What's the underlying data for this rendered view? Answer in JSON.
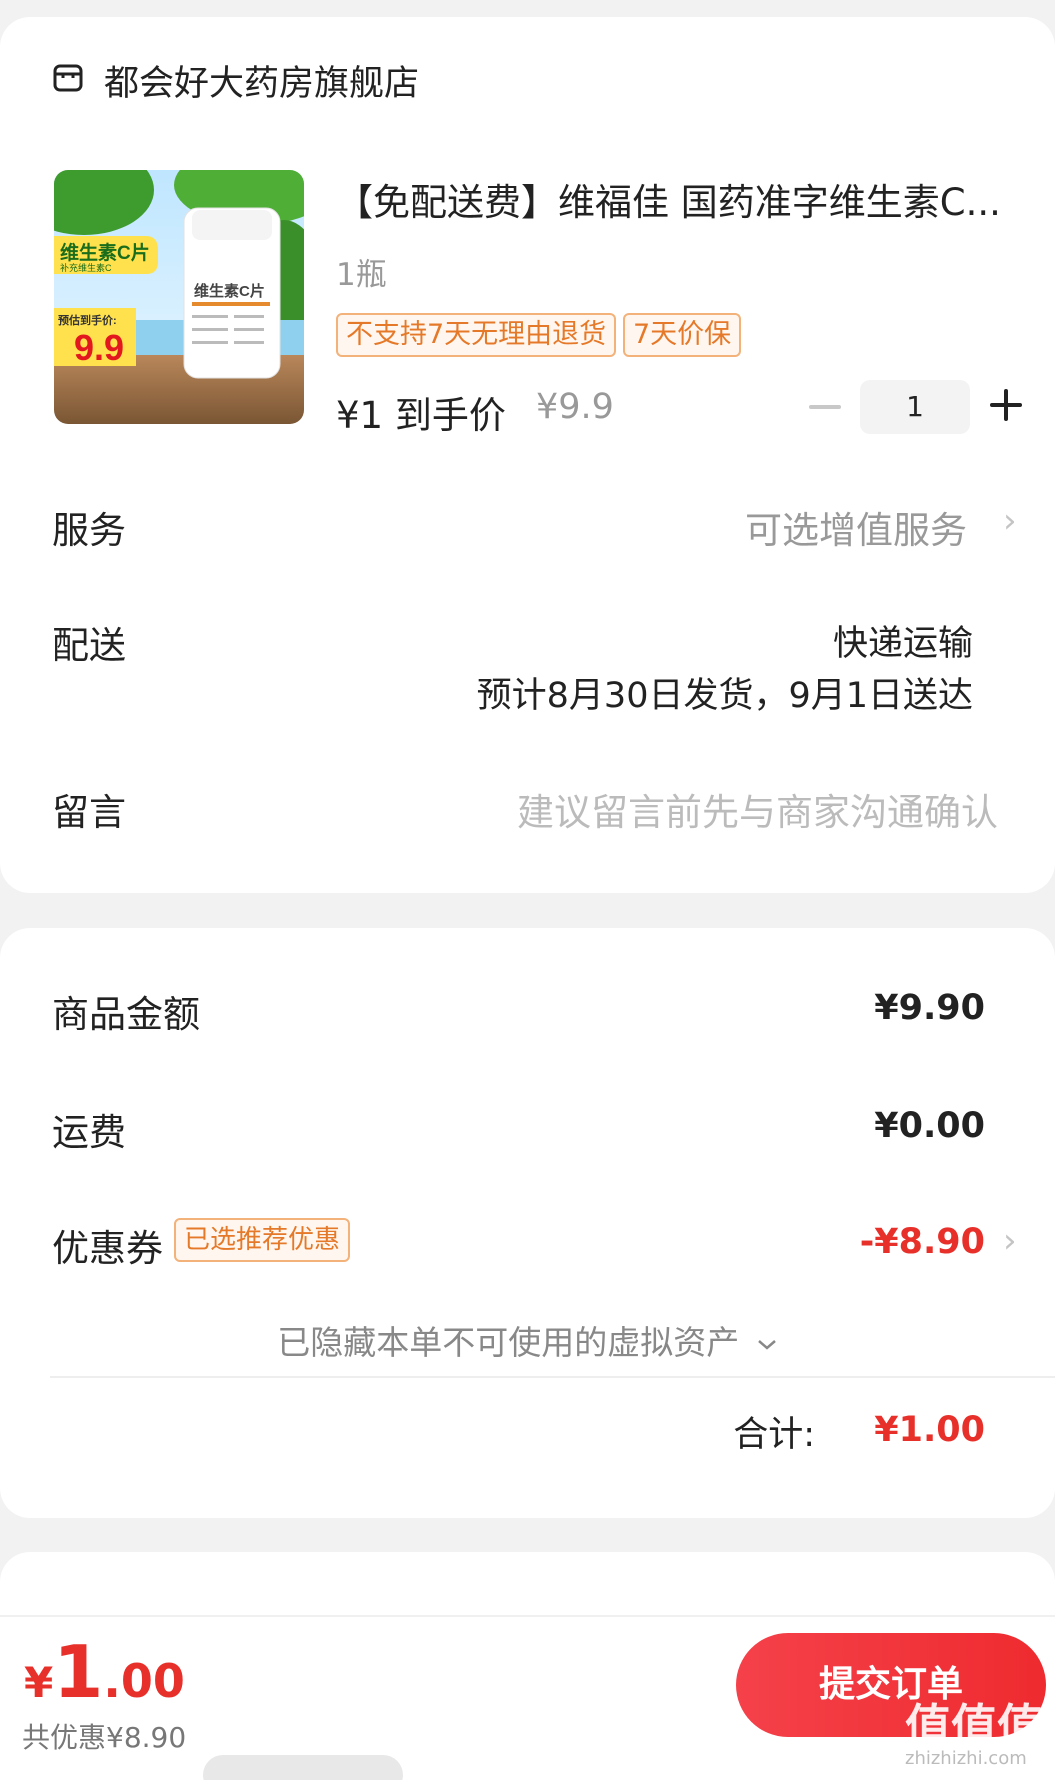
{
  "store": {
    "icon": "store-icon",
    "name": "都会好大药房旗舰店"
  },
  "product": {
    "title": "【免配送费】维福佳 国药准字维生素C...",
    "spec": "1瓶",
    "tags": [
      "不支持7天无理由退货",
      "7天价保"
    ],
    "price_now": "¥1 到手价",
    "price_original": "¥9.9",
    "quantity": "1",
    "image": {
      "badge_title": "维生素C片",
      "badge_sub": "补充维生素C",
      "estimate_label": "预估到手价:",
      "estimate_price": "9.9",
      "bottle_label": "维生素C片"
    }
  },
  "service": {
    "label": "服务",
    "value": "可选增值服务"
  },
  "delivery": {
    "label": "配送",
    "method": "快递运输",
    "eta": "预计8月30日发货，9月1日送达"
  },
  "note": {
    "label": "留言",
    "placeholder": "建议留言前先与商家沟通确认"
  },
  "summary": {
    "goods_label": "商品金额",
    "goods_value": "¥9.90",
    "shipping_label": "运费",
    "shipping_value": "¥0.00",
    "coupon_label": "优惠券",
    "coupon_tag": "已选推荐优惠",
    "coupon_value": "-¥8.90",
    "hidden_assets": "已隐藏本单不可使用的虚拟资产",
    "total_label": "合计:",
    "total_value": "¥1.00"
  },
  "footer": {
    "currency": "¥",
    "price_int": "1",
    "price_dec": ".00",
    "saved": "共优惠¥8.90",
    "submit_label": "提交订单"
  },
  "watermark": {
    "text": "值值值",
    "domain": "zhizhizhi.com"
  },
  "colors": {
    "accent_red": "#e8302a",
    "tag_orange": "#e5792a"
  }
}
